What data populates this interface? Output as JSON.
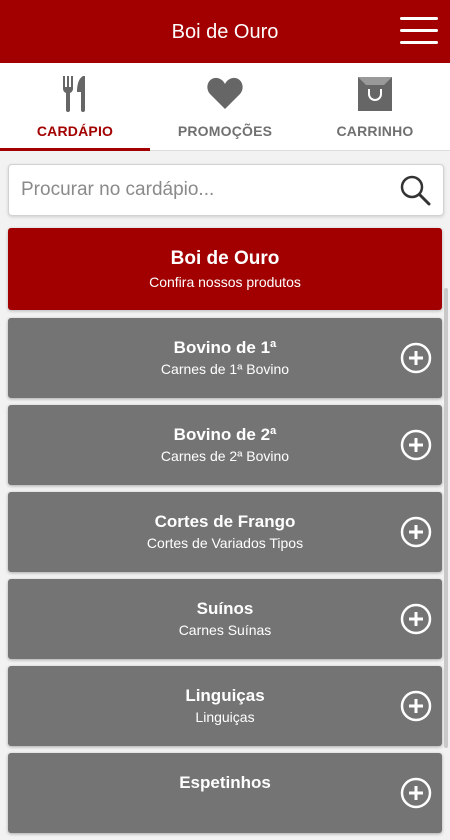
{
  "header": {
    "title": "Boi de Ouro"
  },
  "tabs": [
    {
      "label": "CARDÁPIO",
      "icon": "fork-knife-icon"
    },
    {
      "label": "PROMOÇÕES",
      "icon": "heart-icon"
    },
    {
      "label": "CARRINHO",
      "icon": "shopping-bag-icon"
    }
  ],
  "search": {
    "placeholder": "Procurar no cardápio..."
  },
  "hero": {
    "title": "Boi de Ouro",
    "subtitle": "Confira nossos produtos"
  },
  "categories": [
    {
      "name": "Bovino de 1ª",
      "desc": "Carnes de 1ª Bovino"
    },
    {
      "name": "Bovino de 2ª",
      "desc": "Carnes de 2ª Bovino"
    },
    {
      "name": "Cortes de Frango",
      "desc": "Cortes de Variados Tipos"
    },
    {
      "name": "Suínos",
      "desc": "Carnes Suínas"
    },
    {
      "name": "Linguiças",
      "desc": "Linguiças"
    },
    {
      "name": "Espetinhos",
      "desc": ""
    }
  ],
  "colors": {
    "brand": "#a20000",
    "card": "#747474",
    "tab_inactive": "#707070"
  }
}
